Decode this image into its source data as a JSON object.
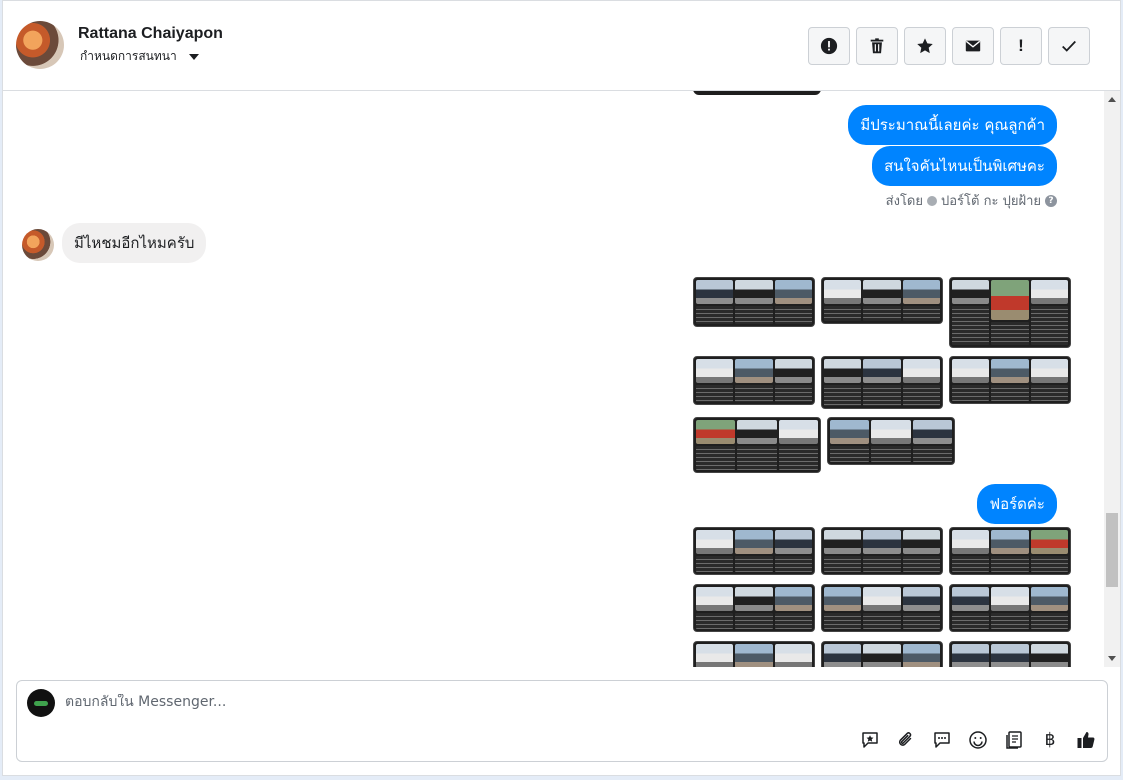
{
  "header": {
    "contact_name": "Rattana Chaiyapon",
    "assign_label": "กำหนดการสนทนา",
    "toolbar": [
      {
        "icon": "alert-circle-icon"
      },
      {
        "icon": "trash-icon"
      },
      {
        "icon": "star-icon"
      },
      {
        "icon": "envelope-icon"
      },
      {
        "icon": "exclamation-icon",
        "text": "!"
      },
      {
        "icon": "checkmark-icon"
      }
    ]
  },
  "thread": {
    "messages_out_1": "มีประมาณนี้เลยค่ะ คุณลูกค้า",
    "messages_out_2": "สนใจคันไหนเป็นพิเศษคะ",
    "sent_by_prefix": "ส่งโดย",
    "sent_by_name": "ปอร์โต้ กะ ปุยฝ้าย",
    "incoming_message": "มีไหชมอีกไหมครับ",
    "messages_out_3": "ฟอร์ดค่ะ"
  },
  "composer": {
    "placeholder": "ตอบกลับใน Messenger...",
    "baht_symbol": "฿",
    "tools": [
      "saved-reply-icon",
      "attachment-icon",
      "chat-bubble-icon",
      "emoji-icon",
      "notes-icon",
      "baht-icon",
      "thumbs-up-icon"
    ]
  },
  "colors": {
    "accent": "#0084ff",
    "incoming_bubble": "#f1f0f0",
    "page_bg": "#e4ecf7"
  }
}
